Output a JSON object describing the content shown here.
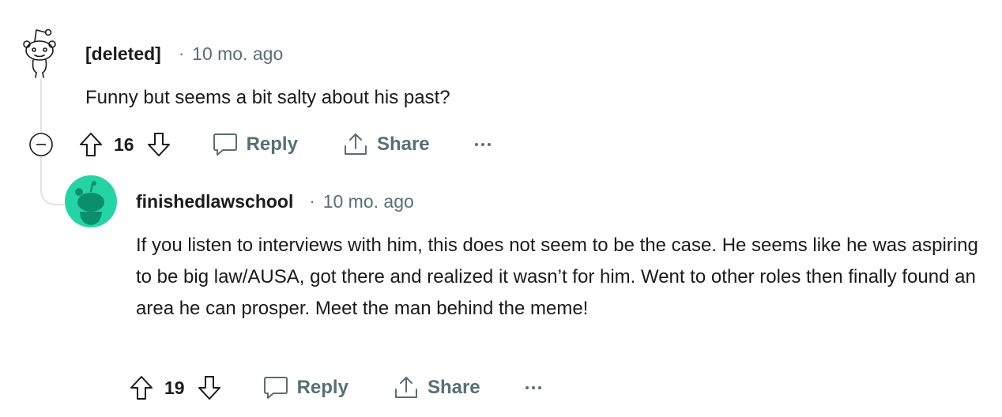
{
  "comments": [
    {
      "author": "[deleted]",
      "separator": "·",
      "time": "10 mo. ago",
      "body": "Funny but seems a bit salty about his past?",
      "votes": "16",
      "actions": {
        "reply": "Reply",
        "share": "Share"
      }
    },
    {
      "author": "finishedlawschool",
      "separator": "·",
      "time": "10 mo. ago",
      "body": "If you listen to interviews with him, this does not seem to be the case. He seems like he was aspiring to be big law/AUSA, got there and realized it wasn’t for him. Went to other roles then finally found an area he can prosper. Meet the man behind the meme!",
      "votes": "19",
      "actions": {
        "reply": "Reply",
        "share": "Share"
      }
    }
  ],
  "colors": {
    "avatar_bg": "#24d4a4",
    "avatar_fg": "#0a8f6a",
    "thread_line": "#dfe3e6",
    "meta_text": "#576f76"
  }
}
